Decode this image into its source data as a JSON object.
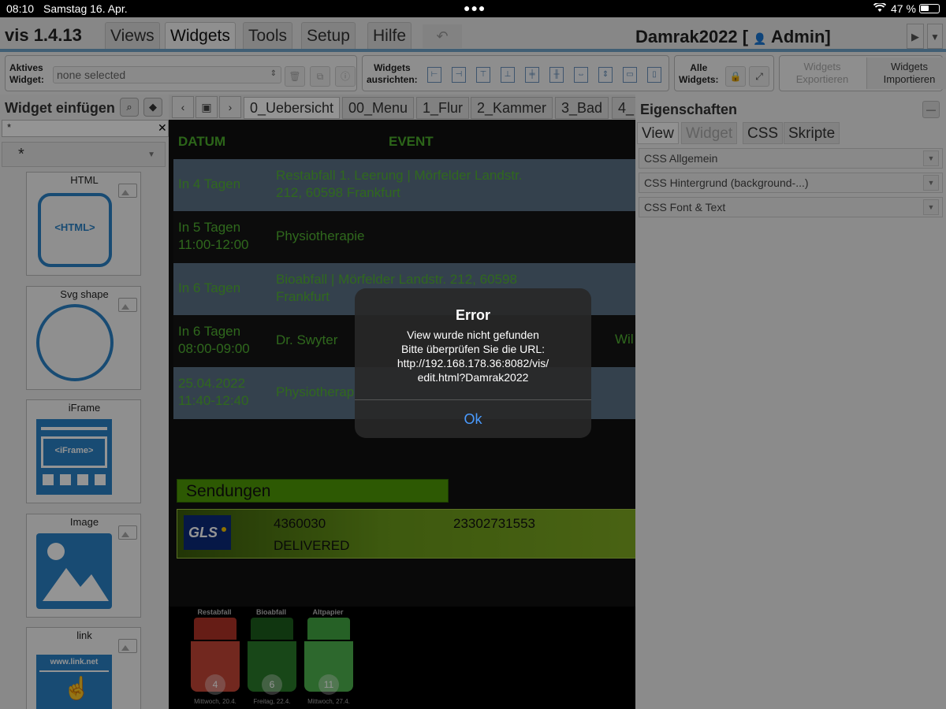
{
  "status_bar": {
    "time": "08:10",
    "date": "Samstag 16. Apr.",
    "battery": "47 %"
  },
  "menubar": {
    "app_title": "vis 1.4.13",
    "tabs": [
      "Views",
      "Widgets",
      "Tools",
      "Setup",
      "Hilfe"
    ],
    "active_tab": "Widgets",
    "project_title": "Damrak2022 [",
    "user": "Admin]"
  },
  "toolbar": {
    "active_widget_label_1": "Aktives",
    "active_widget_label_2": "Widget:",
    "active_widget_value": "none selected",
    "align_label_1": "Widgets",
    "align_label_2": "ausrichten:",
    "all_widgets_label_1": "Alle",
    "all_widgets_label_2": "Widgets:",
    "export_label_1": "Widgets",
    "export_label_2": "Exportieren",
    "import_label_1": "Widgets",
    "import_label_2": "Importieren"
  },
  "left_panel": {
    "title": "Widget einfügen",
    "filter_value": "*",
    "category_value": "*",
    "widgets": [
      {
        "name": "HTML",
        "badge": "<HTML>"
      },
      {
        "name": "Svg shape"
      },
      {
        "name": "iFrame",
        "badge": "<iFrame>"
      },
      {
        "name": "Image"
      },
      {
        "name": "link",
        "badge": "www.link.net"
      }
    ]
  },
  "view_tabs": [
    "0_Uebersicht",
    "00_Menu",
    "1_Flur",
    "2_Kammer",
    "3_Bad",
    "4_"
  ],
  "active_view_tab": "0_Uebersicht",
  "calendar": {
    "col_date": "DATUM",
    "col_event": "EVENT",
    "rows": [
      {
        "date_1": "In 4 Tagen",
        "date_2": "",
        "event_1": "Restabfall 1. Leerung | Mörfelder Landstr.",
        "event_2": "212, 60598 Frankfurt",
        "extra": ""
      },
      {
        "date_1": "In 5 Tagen",
        "date_2": "11:00-12:00",
        "event_1": "Physiotherapie",
        "event_2": "",
        "extra": ""
      },
      {
        "date_1": "In 6 Tagen",
        "date_2": "",
        "event_1": "Bioabfall | Mörfelder Landstr. 212, 60598",
        "event_2": "Frankfurt",
        "extra": ""
      },
      {
        "date_1": "In 6 Tagen",
        "date_2": "08:00-09:00",
        "event_1": "Dr. Swyter",
        "event_2": "",
        "extra": "Wil"
      },
      {
        "date_1": "25.04.2022",
        "date_2": "11:40-12:40",
        "event_1": "Physiotherap",
        "event_2": "",
        "extra": ""
      }
    ]
  },
  "sendungen": {
    "title": "Sendungen",
    "carrier": "GLS",
    "id": "4360030",
    "tracking": "23302731553",
    "status": "DELIVERED"
  },
  "bins": [
    {
      "label": "Restabfall",
      "days": "4",
      "date": "Mittwoch, 20.4.",
      "color": "#c0392b"
    },
    {
      "label": "Bioabfall",
      "days": "6",
      "date": "Freitag, 22.4.",
      "color": "#1f7a1f"
    },
    {
      "label": "Altpapier",
      "days": "11",
      "date": "Mittwoch, 27.4.",
      "color": "#3fa33f"
    }
  ],
  "right_panel": {
    "title": "Eigenschaften",
    "tabs": [
      "View",
      "Widget",
      "CSS",
      "Skripte"
    ],
    "sections": [
      "CSS Allgemein",
      "CSS Hintergrund (background-...)",
      "CSS Font & Text"
    ]
  },
  "dialog": {
    "title": "Error",
    "lines": [
      "View wurde nicht gefunden",
      "Bitte überprüfen Sie die URL:",
      "http://192.168.178.36:8082/vis/",
      "edit.html?Damrak2022"
    ],
    "ok_label": "Ok"
  }
}
